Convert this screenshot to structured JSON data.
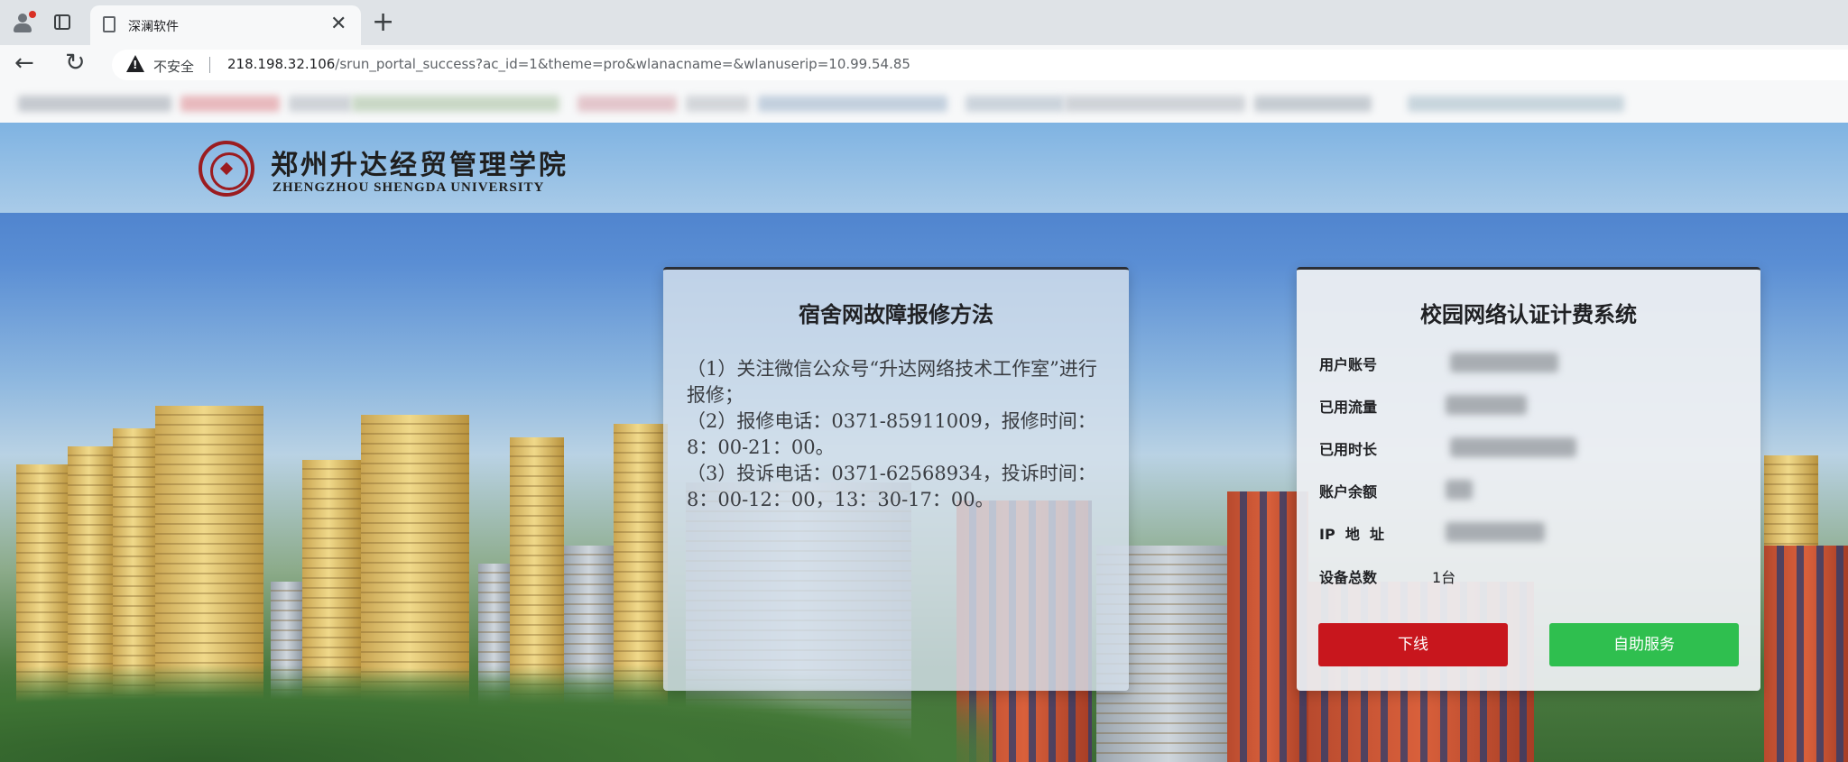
{
  "browser": {
    "tab_title": "深澜软件",
    "tab_close": "✕",
    "new_tab": "+",
    "security_label": "不安全",
    "url_host": "218.198.32.106",
    "url_path": "/srun_portal_success?ac_id=1&theme=pro&wlanacname=&wlanuserip=10.99.54.85"
  },
  "header": {
    "school_name_cn": "郑州升达经贸管理学院",
    "school_name_en": "ZHENGZHOU SHENGDA UNIVERSITY"
  },
  "repair_card": {
    "title": "宿舍网故障报修方法",
    "lines": [
      "（1）关注微信公众号“升达网络技术工作室”进行报修；",
      "（2）报修电话：0371-85911009，报修时间：8：00-21：00。",
      "（3）投诉电话：0371-62568934，投诉时间：8：00-12：00，13：30-17：00。"
    ]
  },
  "auth_card": {
    "title": "校园网络认证计费系统",
    "fields": [
      {
        "label": "用户账号",
        "value": ""
      },
      {
        "label": "已用流量",
        "value": ""
      },
      {
        "label": "已用时长",
        "value": ""
      },
      {
        "label": "账户余额",
        "value": ""
      },
      {
        "label": "IP  地  址",
        "value": ""
      },
      {
        "label": "设备总数",
        "value": "1台"
      }
    ],
    "logout_label": "下线",
    "self_service_label": "自助服务"
  },
  "colors": {
    "logout": "#c8161d",
    "self_service": "#2fbf4f",
    "emblem": "#9b1c20"
  }
}
